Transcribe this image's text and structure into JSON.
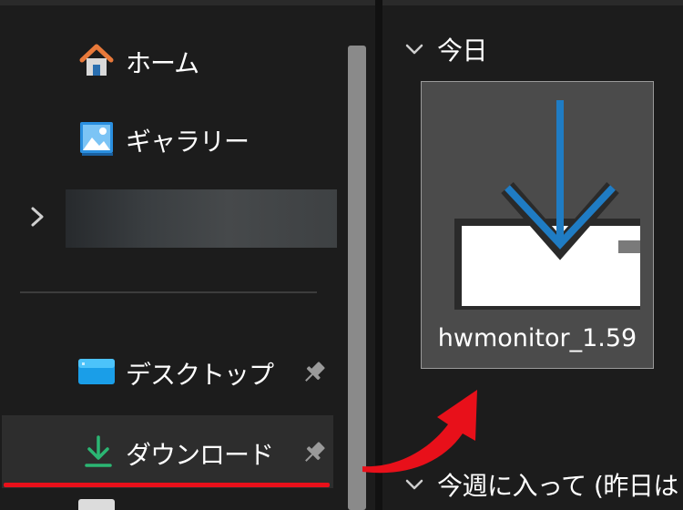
{
  "nav": {
    "items": [
      {
        "id": "home",
        "label": "ホーム",
        "icon": "home-icon"
      },
      {
        "id": "gallery",
        "label": "ギャラリー",
        "icon": "gallery-icon"
      },
      {
        "id": "blurred",
        "label": "",
        "icon": "chevron-right-icon"
      },
      {
        "id": "desktop",
        "label": "デスクトップ",
        "icon": "desktop-folder-icon",
        "pinned": true
      },
      {
        "id": "downloads",
        "label": "ダウンロード",
        "icon": "download-folder-icon",
        "pinned": true,
        "selected": true
      }
    ]
  },
  "content": {
    "groups": [
      {
        "label": "今日",
        "icon": "chevron-down-icon"
      },
      {
        "label": "今週に入って (昨日は",
        "icon": "chevron-down-icon"
      }
    ],
    "files": [
      {
        "name": "hwmonitor_1.59",
        "icon": "installer-download-icon"
      }
    ]
  },
  "colors": {
    "background": "#1c1c1c",
    "selected_item": "#2d2d2d",
    "accent_blue": "#1f7cc4",
    "download_green": "#2bb673",
    "annotation_red": "#e8101a"
  }
}
